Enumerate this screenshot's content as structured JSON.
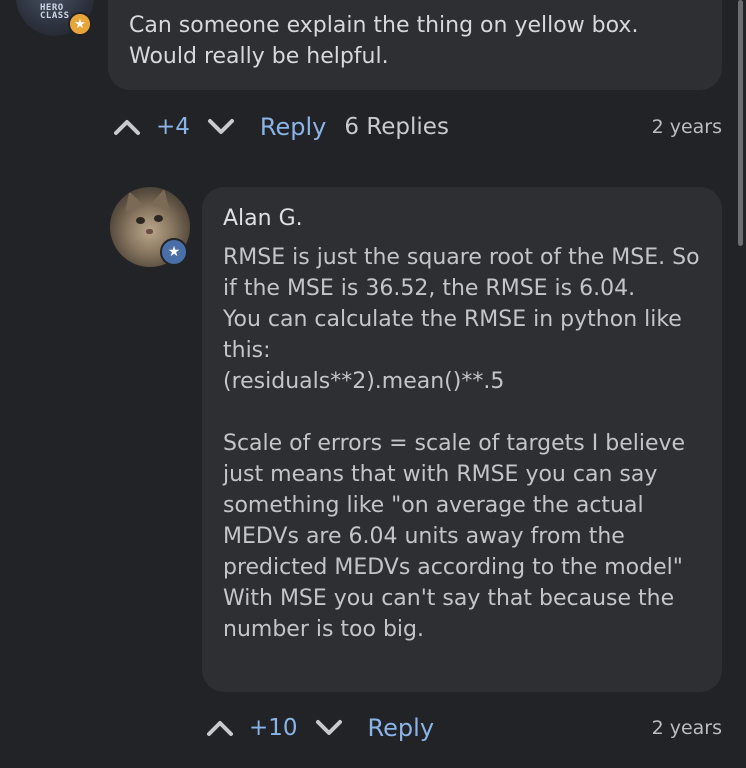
{
  "comment": {
    "avatar_text": "HERO\nCLASS",
    "badge_icon": "star-icon",
    "text": "Can someone explain the thing on yellow box.\nWould really be helpful.",
    "votes": "+4",
    "reply_label": "Reply",
    "replies_label": "6 Replies",
    "timestamp": "2 years"
  },
  "reply": {
    "author": "Alan G.",
    "badge_icon": "star-icon",
    "text": "RMSE is just the square root of the MSE. So if the MSE is 36.52, the RMSE is 6.04.\nYou can calculate the RMSE in python like this:\n(residuals**2).mean()**.5\n\nScale of errors = scale of targets I believe just means that with RMSE you can say something like \"on average the actual MEDVs are 6.04 units away from the predicted MEDVs according to the model\" With MSE you can't say that because the number is too big.",
    "votes": "+10",
    "reply_label": "Reply",
    "timestamp": "2 years"
  },
  "colors": {
    "background": "#222326",
    "bubble": "#2e2f33",
    "link": "#8ab4e8",
    "gold_badge": "#e8a53a",
    "blue_badge": "#4a6ea8"
  }
}
